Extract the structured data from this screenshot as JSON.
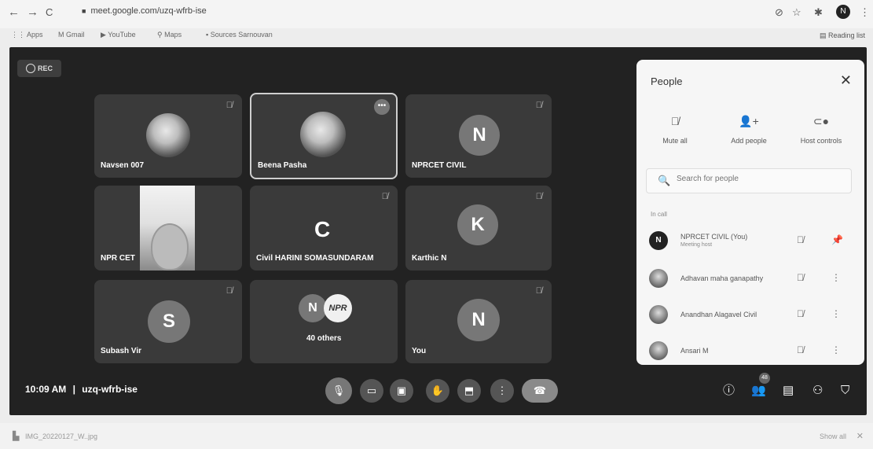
{
  "browser": {
    "back": "←",
    "forward": "→",
    "reload": "C",
    "url": "meet.google.com/uzq-wfrb-ise",
    "profile_initial": "N",
    "bookmarks": [
      "Apps",
      "Gmail",
      "YouTube",
      "Maps",
      "Sources Sarnouvan"
    ],
    "reading_list": "Reading list"
  },
  "meet": {
    "rec_label": "REC",
    "tiles": [
      {
        "name": "Navsen 007"
      },
      {
        "name": "Beena Pasha"
      },
      {
        "name": "NPRCET CIVIL",
        "letter": "N"
      },
      {
        "name": "NPR CET"
      },
      {
        "name": "Civil HARINI SOMASUNDARAM",
        "letter": "C"
      },
      {
        "name": "Karthic N",
        "letter": "K"
      },
      {
        "name": "Subash Vir",
        "letter": "S"
      },
      {
        "name": "40 others",
        "letter": "N",
        "logo": "NPR"
      },
      {
        "name": "You",
        "letter": "N"
      }
    ],
    "time": "10:09 AM",
    "separator": "|",
    "meeting_code": "uzq-wfrb-ise",
    "participants_count": "48"
  },
  "panel": {
    "title": "People",
    "actions": [
      {
        "label": "Mute all"
      },
      {
        "label": "Add people"
      },
      {
        "label": "Host controls"
      }
    ],
    "search_placeholder": "Search for people",
    "section_label": "In call",
    "people": [
      {
        "name": "NPRCET CIVIL (You)",
        "sub": "Meeting host",
        "initial": "N"
      },
      {
        "name": "Adhavan maha ganapathy"
      },
      {
        "name": "Anandhan Alagavel Civil"
      },
      {
        "name": "Ansari M"
      }
    ]
  },
  "downloads": {
    "file": "IMG_20220127_W..jpg",
    "show_all": "Show all"
  }
}
